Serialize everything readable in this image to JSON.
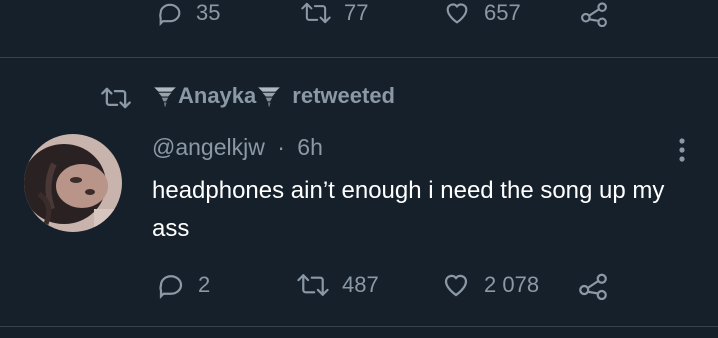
{
  "prev_tweet_actions": {
    "reply_count": "35",
    "retweet_count": "77",
    "like_count": "657"
  },
  "retweet_header": {
    "retweeter_name": "Anayka",
    "retweeted_label": "retweeted"
  },
  "tweet": {
    "handle": "@angelkjw",
    "separator": "·",
    "time": "6h",
    "text": "headphones ain’t enough i need the song up my ass",
    "reply_count": "2",
    "retweet_count": "487",
    "like_count": "2 078"
  },
  "icons": {
    "reply": "reply-icon",
    "retweet": "retweet-icon",
    "like": "heart-icon",
    "share": "share-icon",
    "more": "more-icon",
    "tornado": "tornado-emoji"
  },
  "colors": {
    "background": "#15202b",
    "muted": "#8b98a5",
    "text": "#ffffff",
    "divider": "#38444d"
  }
}
